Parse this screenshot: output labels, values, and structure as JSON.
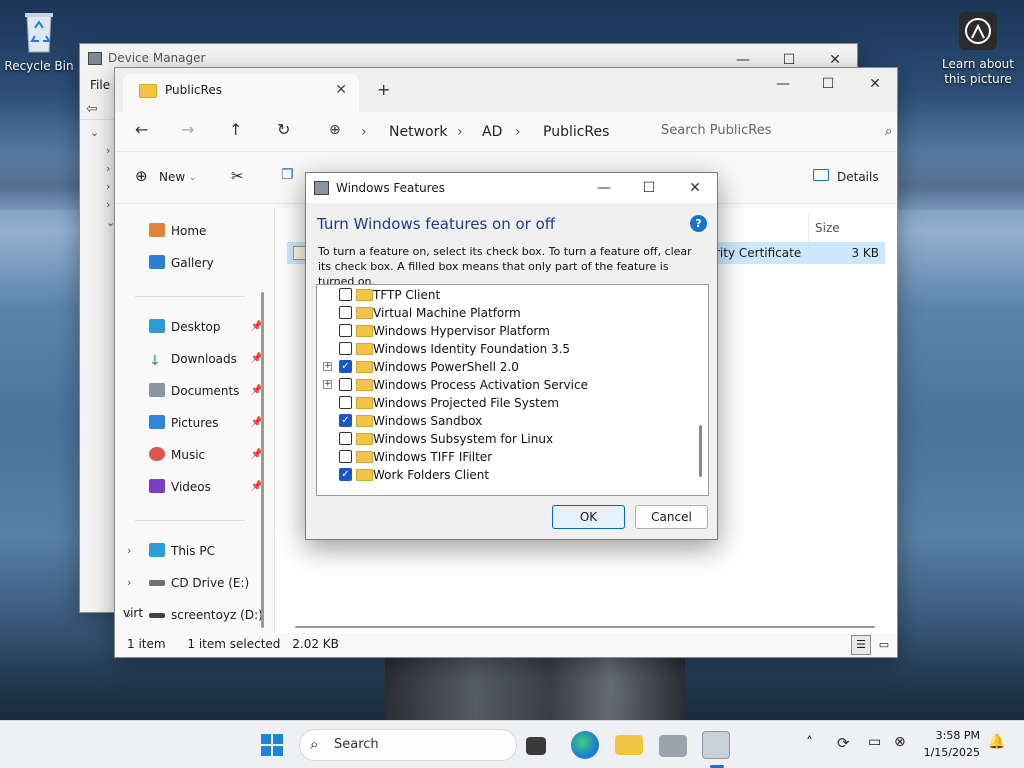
{
  "desktop": {
    "recycle_bin": "Recycle Bin",
    "learn_about": "Learn about this picture"
  },
  "device_manager": {
    "title": "Device Manager",
    "menu": "File",
    "caption": {
      "min": "—",
      "max": "☐",
      "close": "✕"
    }
  },
  "explorer": {
    "tab_title": "PublicRes",
    "tab_close": "✕",
    "new_tab": "+",
    "breadcrumb": [
      "Network",
      "AD",
      "PublicRes"
    ],
    "search_placeholder": "Search PublicRes",
    "toolbar": {
      "new": "New",
      "details": "Details"
    },
    "sidebar": {
      "quick": [
        "Home",
        "Gallery"
      ],
      "pinned": [
        "Desktop",
        "Downloads",
        "Documents",
        "Pictures",
        "Music",
        "Videos"
      ],
      "drives": [
        "This PC",
        "CD Drive (E:) virt",
        "screentoyz (D:)"
      ]
    },
    "columns": {
      "size": "Size"
    },
    "file": {
      "name_tail": "rity Certificate",
      "size": "3 KB"
    },
    "status": {
      "count": "1 item",
      "selected": "1 item selected",
      "selected_size": "2.02 KB"
    }
  },
  "features_dialog": {
    "title": "Windows Features",
    "heading": "Turn Windows features on or off",
    "help": "?",
    "description": "To turn a feature on, select its check box. To turn a feature off, clear its check box. A filled box means that only part of the feature is turned on.",
    "features": [
      {
        "label": "TFTP Client",
        "checked": false,
        "expandable": false
      },
      {
        "label": "Virtual Machine Platform",
        "checked": false,
        "expandable": false
      },
      {
        "label": "Windows Hypervisor Platform",
        "checked": false,
        "expandable": false
      },
      {
        "label": "Windows Identity Foundation 3.5",
        "checked": false,
        "expandable": false
      },
      {
        "label": "Windows PowerShell 2.0",
        "checked": true,
        "expandable": true
      },
      {
        "label": "Windows Process Activation Service",
        "checked": false,
        "expandable": true
      },
      {
        "label": "Windows Projected File System",
        "checked": false,
        "expandable": false
      },
      {
        "label": "Windows Sandbox",
        "checked": true,
        "expandable": false
      },
      {
        "label": "Windows Subsystem for Linux",
        "checked": false,
        "expandable": false
      },
      {
        "label": "Windows TIFF IFilter",
        "checked": false,
        "expandable": false
      },
      {
        "label": "Work Folders Client",
        "checked": true,
        "expandable": false
      }
    ],
    "ok": "OK",
    "cancel": "Cancel"
  },
  "taskbar": {
    "search": "Search",
    "time": "3:58 PM",
    "date": "1/15/2025"
  }
}
